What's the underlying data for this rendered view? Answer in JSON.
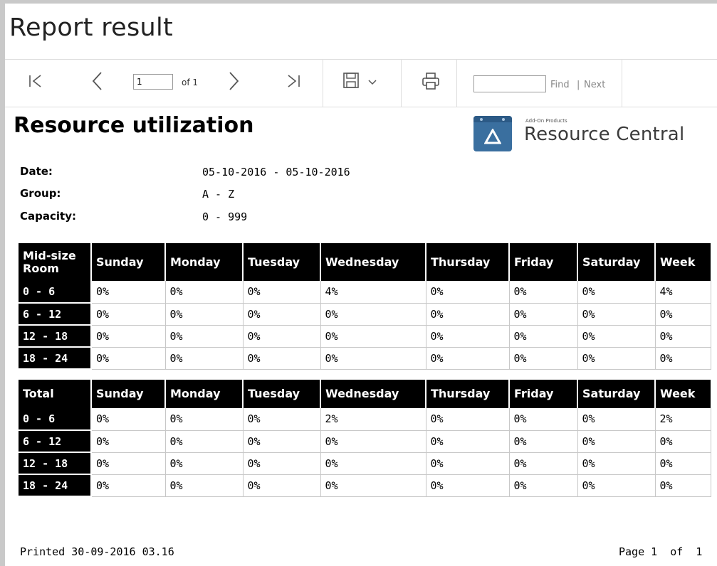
{
  "window": {
    "title": "Report result"
  },
  "toolbar": {
    "page_value": "1",
    "of_label": "of 1",
    "find_label": "Find",
    "find_separator": "|",
    "next_label": "Next",
    "find_value": ""
  },
  "report": {
    "title": "Resource utilization",
    "logo": {
      "small_text": "Add-On Products",
      "big_text": "Resource Central",
      "tile_color": "#3a6f9f"
    },
    "meta": [
      {
        "label": "Date:",
        "value": "05-10-2016 - 05-10-2016"
      },
      {
        "label": "Group:",
        "value": "A - Z"
      },
      {
        "label": "Capacity:",
        "value": "0 - 999"
      }
    ],
    "tables": [
      {
        "header": [
          "Mid-size Room",
          "Sunday",
          "Monday",
          "Tuesday",
          "Wednesday",
          "Thursday",
          "Friday",
          "Saturday",
          "Week"
        ],
        "rows": [
          [
            "0 - 6",
            "0%",
            "0%",
            "0%",
            "4%",
            "0%",
            "0%",
            "0%",
            "4%"
          ],
          [
            "6 - 12",
            "0%",
            "0%",
            "0%",
            "0%",
            "0%",
            "0%",
            "0%",
            "0%"
          ],
          [
            "12 - 18",
            "0%",
            "0%",
            "0%",
            "0%",
            "0%",
            "0%",
            "0%",
            "0%"
          ],
          [
            "18 - 24",
            "0%",
            "0%",
            "0%",
            "0%",
            "0%",
            "0%",
            "0%",
            "0%"
          ]
        ]
      },
      {
        "header": [
          "Total",
          "Sunday",
          "Monday",
          "Tuesday",
          "Wednesday",
          "Thursday",
          "Friday",
          "Saturday",
          "Week"
        ],
        "rows": [
          [
            "0 - 6",
            "0%",
            "0%",
            "0%",
            "2%",
            "0%",
            "0%",
            "0%",
            "2%"
          ],
          [
            "6 - 12",
            "0%",
            "0%",
            "0%",
            "0%",
            "0%",
            "0%",
            "0%",
            "0%"
          ],
          [
            "12 - 18",
            "0%",
            "0%",
            "0%",
            "0%",
            "0%",
            "0%",
            "0%",
            "0%"
          ],
          [
            "18 - 24",
            "0%",
            "0%",
            "0%",
            "0%",
            "0%",
            "0%",
            "0%",
            "0%"
          ]
        ]
      }
    ],
    "footer": {
      "printed": "Printed 30-09-2016 03.16",
      "page": "Page 1  of  1"
    }
  },
  "icons": [
    "first-page-icon",
    "previous-page-icon",
    "next-page-icon",
    "last-page-icon",
    "save-icon",
    "chevron-down-icon",
    "print-icon"
  ]
}
